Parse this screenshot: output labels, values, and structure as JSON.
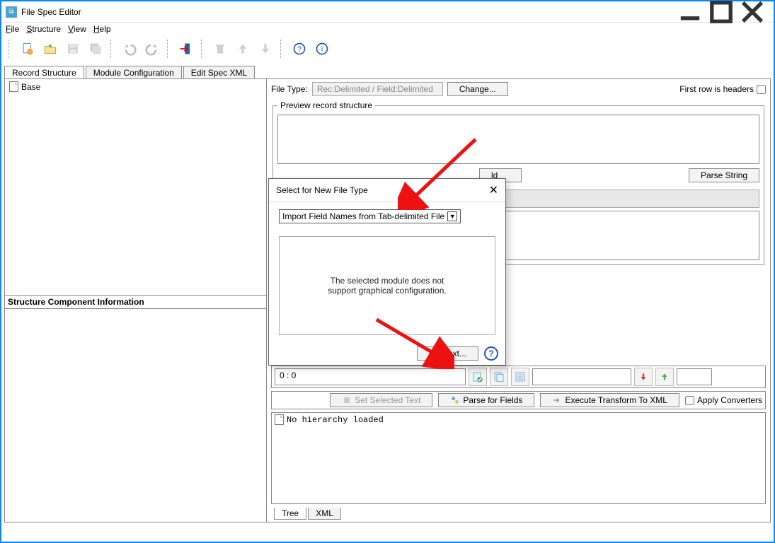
{
  "window": {
    "title": "File Spec Editor"
  },
  "menu": {
    "file": "File",
    "structure": "Structure",
    "view": "View",
    "help": "Help"
  },
  "tabs": {
    "record_structure": "Record Structure",
    "module_config": "Module Configuration",
    "edit_spec_xml": "Edit Spec XML"
  },
  "tree": {
    "root": "Base"
  },
  "sci": {
    "title": "Structure Component Information"
  },
  "right": {
    "file_type_label": "File Type:",
    "file_type_value": "Rec:Delimited / Field:Delimited",
    "change": "Change...",
    "first_row_headers": "First row is headers",
    "preview_legend": "Preview record structure",
    "hidden_button_ld": "ld",
    "parse_string": "Parse String",
    "position": "0 : 0",
    "set_selected_text": "Set Selected Text",
    "parse_for_fields": "Parse for Fields",
    "execute_transform": "Execute Transform To XML",
    "apply_converters": "Apply Converters",
    "no_hierarchy": "No hierarchy loaded",
    "tab_tree": "Tree",
    "tab_xml": "XML"
  },
  "dialog": {
    "title": "Select for New File Type",
    "combo": "Import Field Names from Tab-delimited File",
    "message_line1": "The selected module does not",
    "message_line2": "support graphical configuration.",
    "next": "Next..."
  }
}
